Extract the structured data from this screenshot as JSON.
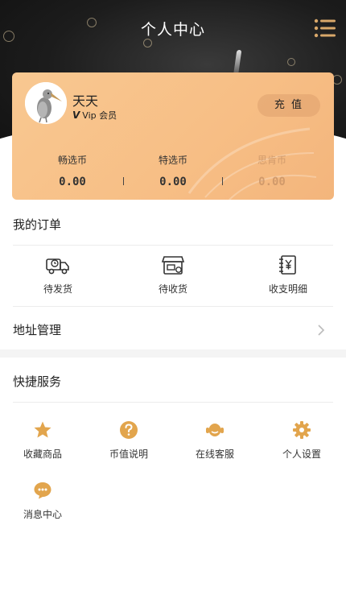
{
  "header": {
    "title": "个人中心",
    "menu_icon": "list-menu-icon"
  },
  "user": {
    "name": "天天",
    "vip_label": "Vip 会员",
    "vip_logo": "V"
  },
  "card": {
    "recharge_label": "充 值",
    "coins": [
      {
        "label": "畅选币",
        "value": "0.00"
      },
      {
        "label": "特选币",
        "value": "0.00"
      },
      {
        "label": "思肯币",
        "value": "0.00"
      }
    ]
  },
  "orders": {
    "title": "我的订单",
    "items": [
      {
        "label": "待发货",
        "icon": "truck-icon"
      },
      {
        "label": "待收货",
        "icon": "store-receive-icon"
      },
      {
        "label": "收支明细",
        "icon": "ledger-icon"
      }
    ]
  },
  "address": {
    "label": "地址管理",
    "icon": "chevron-right-icon"
  },
  "services": {
    "title": "快捷服务",
    "items": [
      {
        "label": "收藏商品",
        "icon": "star-icon"
      },
      {
        "label": "币值说明",
        "icon": "question-icon"
      },
      {
        "label": "在线客服",
        "icon": "customer-service-icon"
      },
      {
        "label": "个人设置",
        "icon": "gear-icon"
      },
      {
        "label": "消息中心",
        "icon": "chat-bubble-icon"
      }
    ]
  },
  "colors": {
    "card": "#f7be85",
    "accent_icon": "#e2a54d",
    "header_bg": "#1c1c1c"
  }
}
